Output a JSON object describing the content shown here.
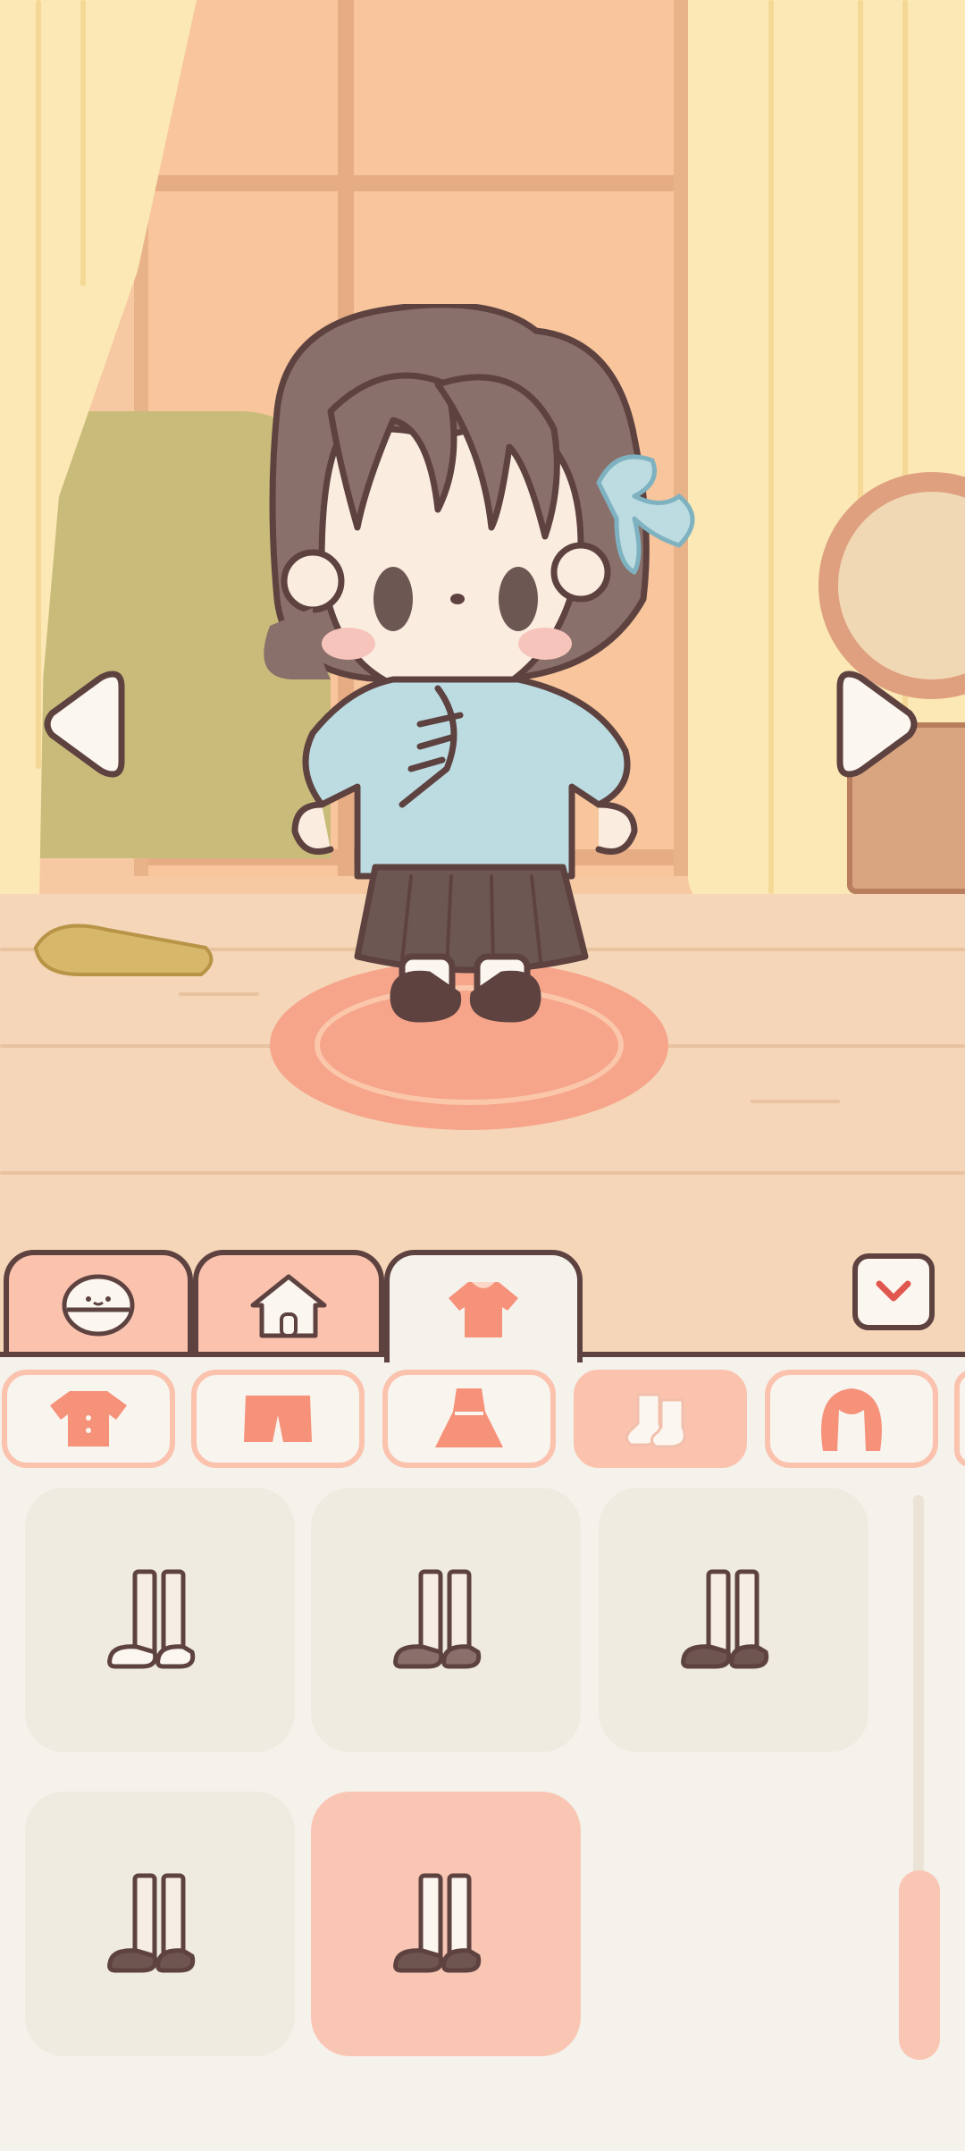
{
  "main_tabs": [
    {
      "id": "character",
      "icon": "face-icon",
      "label": "",
      "active": false
    },
    {
      "id": "home",
      "icon": "house-icon",
      "label": "",
      "active": false
    },
    {
      "id": "clothing",
      "icon": "shirt-icon",
      "label": "",
      "active": true
    }
  ],
  "collapse": {
    "icon": "chevron-down-icon"
  },
  "categories": [
    {
      "id": "tops",
      "icon": "top-icon",
      "active": false
    },
    {
      "id": "bottoms",
      "icon": "shorts-icon",
      "active": false
    },
    {
      "id": "dresses",
      "icon": "dress-icon",
      "active": false
    },
    {
      "id": "socks",
      "icon": "socks-icon",
      "active": true
    },
    {
      "id": "hair",
      "icon": "hair-icon",
      "active": false
    }
  ],
  "items": [
    {
      "sock": "#f6eee4",
      "shoe": "#fbf6ef",
      "selected": false
    },
    {
      "sock": "#f6eee4",
      "shoe": "#8b6f6a",
      "selected": false
    },
    {
      "sock": "#f6eee4",
      "shoe": "#6e5550",
      "selected": false
    },
    {
      "sock": "#f6eee4",
      "shoe": "#6e5550",
      "selected": false
    },
    {
      "sock": "#fbf6ef",
      "shoe": "#6e5550",
      "selected": true
    }
  ],
  "scene": {
    "prev_icon": "left-arrow-icon",
    "next_icon": "right-arrow-icon"
  },
  "colors": {
    "accent": "#fbc2ae",
    "outline": "#5d4240",
    "shirt": "#bcdce2",
    "hair": "#8a706a"
  }
}
